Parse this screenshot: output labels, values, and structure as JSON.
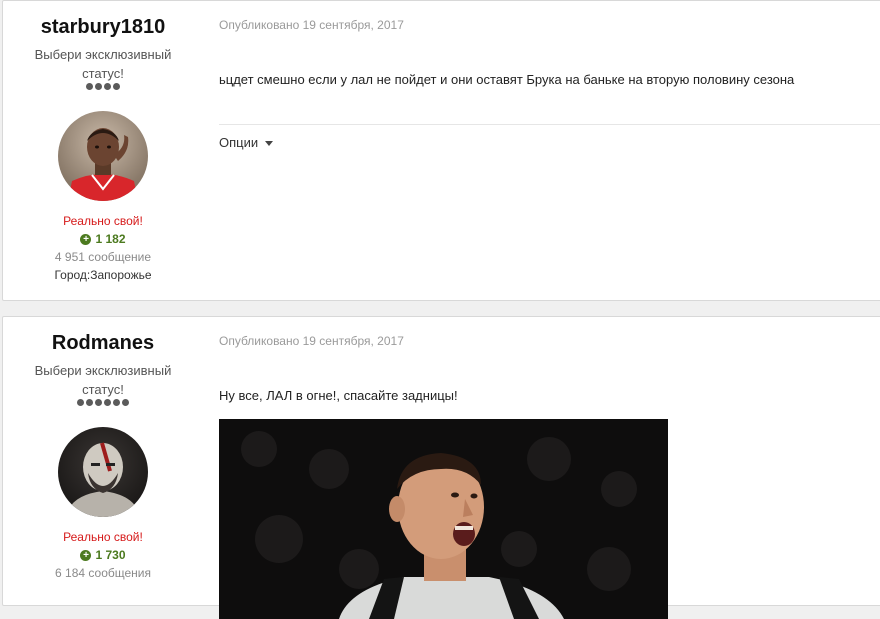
{
  "posts": [
    {
      "username": "starbury1810",
      "status": "Выбери эксклюзивный статус!",
      "rank_pips": 4,
      "group": "Реально свой!",
      "reputation_icon": "plus-circle-icon",
      "reputation": "1 182",
      "post_count": "4 951 сообщение",
      "city": "Город:Запорожье",
      "published": "Опубликовано 19 сентября, 2017",
      "content": "ьцдет смешно если у лал не пойдет и они оставят Брука на баньке на вторую половину сезона",
      "options_label": "Опции"
    },
    {
      "username": "Rodmanes",
      "status": "Выбери эксклюзивный статус!",
      "rank_pips": 6,
      "group": "Реально свой!",
      "reputation_icon": "plus-circle-icon",
      "reputation": "1 730",
      "post_count": "6 184 сообщения",
      "published": "Опубликовано 19 сентября, 2017",
      "content": "Ну все, ЛАЛ в огне!, спасайте задницы!"
    }
  ],
  "colors": {
    "group": "#d61a1a",
    "reputation": "#4c7a1f",
    "meta": "#9a9a9a",
    "pip": "#5b5b5b"
  }
}
